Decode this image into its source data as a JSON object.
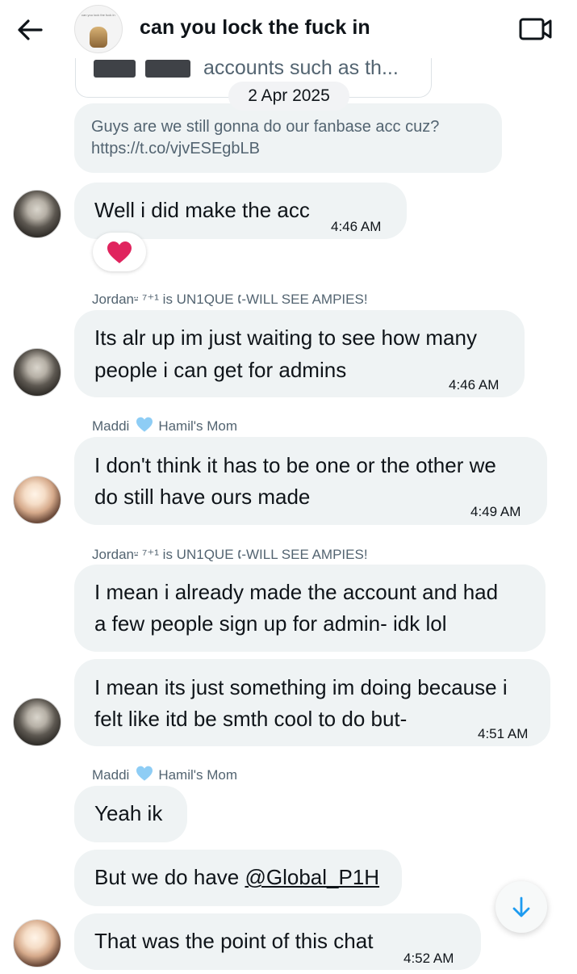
{
  "header": {
    "title": "can you lock the fuck in",
    "avatar_caption": "can you lock the fuck in",
    "back_icon": "arrow-left-icon",
    "video_icon": "video-camera-icon"
  },
  "shared_preview": {
    "text": "accounts such as th..."
  },
  "date_separator": "2 Apr 2025",
  "messages": {
    "m1": {
      "text": "Guys are we still gonna do our fanbase acc cuz? https://t.co/vjvESEgbLB"
    },
    "m2": {
      "text": "Well i did make the acc",
      "time": "4:46 AM",
      "reaction": "red-heart"
    },
    "m3": {
      "sender_name": "Jordan⸚ ⁷⁺¹ is UN1QUE 🕻-WILL SEE AMPIES!",
      "line1": "Its alr up im just waiting to see how many",
      "line2": "people i can get for admins",
      "time": "4:46 AM"
    },
    "m4": {
      "sender_name": "Maddi",
      "sender_suffix": "Hamil's Mom",
      "line1": "I don't think it has to be one or the other we",
      "line2": "do still have ours made",
      "time": "4:49 AM"
    },
    "m5": {
      "sender_name": "Jordan⸚ ⁷⁺¹ is UN1QUE 🕻-WILL SEE AMPIES!",
      "line1": "I mean i already made the account and had",
      "line2": "a few people sign up for admin- idk lol"
    },
    "m6": {
      "line1": "I mean its just something im doing because i",
      "line2": "felt like itd be smth cool to do but-",
      "time": "4:51 AM"
    },
    "m7": {
      "sender_name": "Maddi",
      "sender_suffix": "Hamil's Mom",
      "text": "Yeah ik"
    },
    "m8": {
      "prefix": "But we do have ",
      "mention": "@Global_P1H"
    },
    "m9": {
      "text": "That was the point of this chat",
      "time": "4:52 AM"
    }
  },
  "scroll_button_icon": "arrow-down-icon",
  "colors": {
    "bubble": "#eff3f4",
    "accent_blue": "#1d9bf0",
    "heart_light_blue": "#8ecdf5",
    "reaction_red": "#e0245e"
  }
}
